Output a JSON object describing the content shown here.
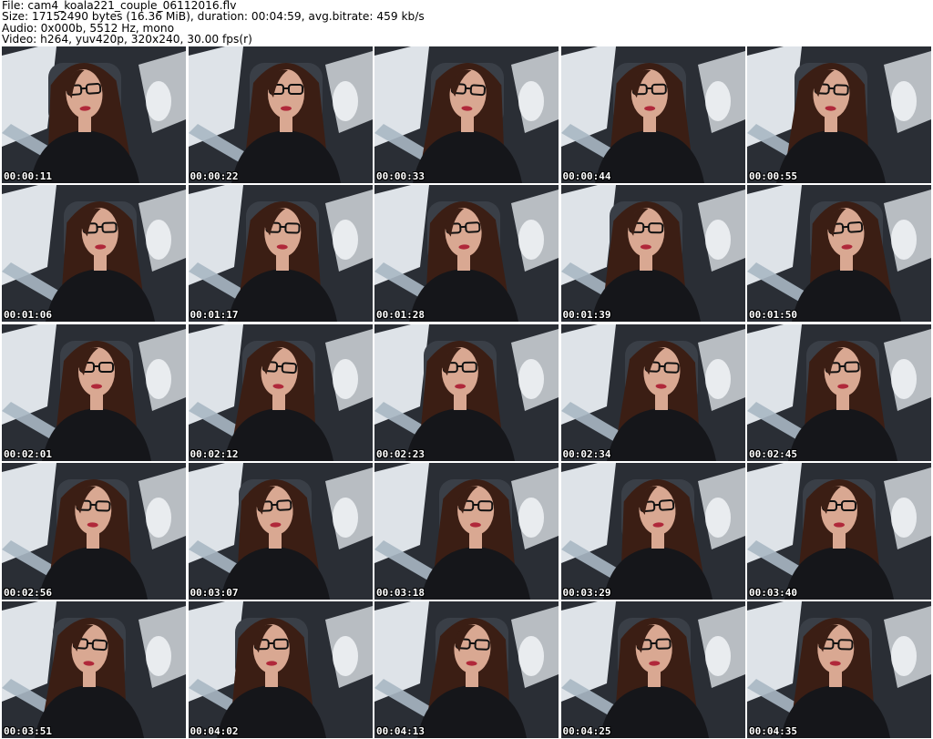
{
  "header": {
    "file_line": "File: cam4_koala221_couple_06112016.flv",
    "size_line": "Size: 17152490 bytes (16.36 MiB), duration: 00:04:59, avg.bitrate: 459 kb/s",
    "audio_line": "Audio: 0x000b, 5512 Hz, mono",
    "video_line": "Video: h264, yuv420p, 320x240, 30.00 fps(r)"
  },
  "thumbnails": [
    {
      "time": "00:00:11"
    },
    {
      "time": "00:00:22"
    },
    {
      "time": "00:00:33"
    },
    {
      "time": "00:00:44"
    },
    {
      "time": "00:00:55"
    },
    {
      "time": "00:01:06"
    },
    {
      "time": "00:01:17"
    },
    {
      "time": "00:01:28"
    },
    {
      "time": "00:01:39"
    },
    {
      "time": "00:01:50"
    },
    {
      "time": "00:02:01"
    },
    {
      "time": "00:02:12"
    },
    {
      "time": "00:02:23"
    },
    {
      "time": "00:02:34"
    },
    {
      "time": "00:02:45"
    },
    {
      "time": "00:02:56"
    },
    {
      "time": "00:03:07"
    },
    {
      "time": "00:03:18"
    },
    {
      "time": "00:03:29"
    },
    {
      "time": "00:03:40"
    },
    {
      "time": "00:03:51"
    },
    {
      "time": "00:04:02"
    },
    {
      "time": "00:04:13"
    },
    {
      "time": "00:04:25"
    },
    {
      "time": "00:04:35"
    }
  ],
  "colors": {
    "window": "#e8edf2",
    "car_interior": "#2a2e35",
    "seat": "#3a3f47",
    "belt": "#a9b7c3",
    "hair": "#3b1e14",
    "skin": "#d9a892",
    "top": "#15161a",
    "lips": "#b0283a"
  }
}
